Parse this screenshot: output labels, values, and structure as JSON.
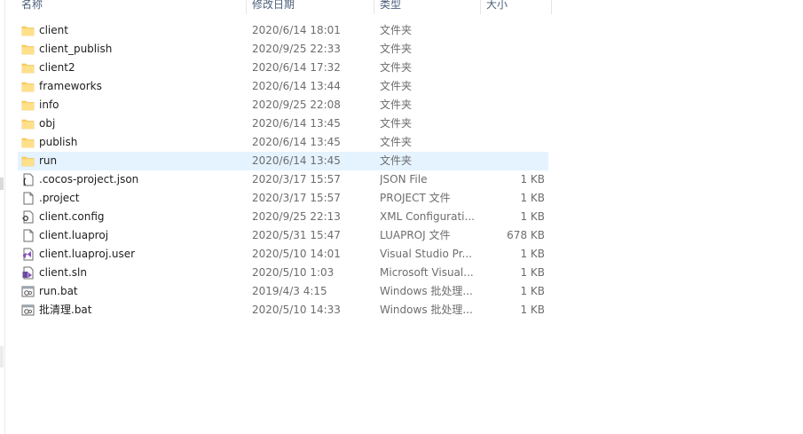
{
  "header": {
    "name": "名称",
    "date": "修改日期",
    "type": "类型",
    "size": "大小"
  },
  "files": [
    {
      "name": "client",
      "date": "2020/6/14 18:01",
      "type": "文件夹",
      "size": "",
      "icon": "folder-icon"
    },
    {
      "name": "client_publish",
      "date": "2020/9/25 22:33",
      "type": "文件夹",
      "size": "",
      "icon": "folder-icon"
    },
    {
      "name": "client2",
      "date": "2020/6/14 17:32",
      "type": "文件夹",
      "size": "",
      "icon": "folder-icon"
    },
    {
      "name": "frameworks",
      "date": "2020/6/14 13:44",
      "type": "文件夹",
      "size": "",
      "icon": "folder-icon"
    },
    {
      "name": "info",
      "date": "2020/9/25 22:08",
      "type": "文件夹",
      "size": "",
      "icon": "folder-icon"
    },
    {
      "name": "obj",
      "date": "2020/6/14 13:45",
      "type": "文件夹",
      "size": "",
      "icon": "folder-icon"
    },
    {
      "name": "publish",
      "date": "2020/6/14 13:45",
      "type": "文件夹",
      "size": "",
      "icon": "folder-icon"
    },
    {
      "name": "run",
      "date": "2020/6/14 13:45",
      "type": "文件夹",
      "size": "",
      "icon": "folder-icon",
      "selected": true
    },
    {
      "name": ".cocos-project.json",
      "date": "2020/3/17 15:57",
      "type": "JSON File",
      "size": "1 KB",
      "icon": "json-file-icon"
    },
    {
      "name": ".project",
      "date": "2020/3/17 15:57",
      "type": "PROJECT 文件",
      "size": "1 KB",
      "icon": "blank-file-icon"
    },
    {
      "name": "client.config",
      "date": "2020/9/25 22:13",
      "type": "XML Configurati...",
      "size": "1 KB",
      "icon": "config-file-icon"
    },
    {
      "name": "client.luaproj",
      "date": "2020/5/31 15:47",
      "type": "LUAPROJ 文件",
      "size": "678 KB",
      "icon": "blank-file-icon"
    },
    {
      "name": "client.luaproj.user",
      "date": "2020/5/10 14:01",
      "type": "Visual Studio Pr...",
      "size": "1 KB",
      "icon": "visual-studio-file-icon"
    },
    {
      "name": "client.sln",
      "date": "2020/5/10 1:03",
      "type": "Microsoft Visual...",
      "size": "1 KB",
      "icon": "solution-file-icon"
    },
    {
      "name": "run.bat",
      "date": "2019/4/3 4:15",
      "type": "Windows 批处理...",
      "size": "1 KB",
      "icon": "batch-file-icon"
    },
    {
      "name": "批清理.bat",
      "date": "2020/5/10 14:33",
      "type": "Windows 批处理...",
      "size": "1 KB",
      "icon": "batch-file-icon"
    }
  ],
  "colors": {
    "selection": "#e5f3ff",
    "folder": "#ffd25d",
    "header_text": "#4c607a"
  }
}
